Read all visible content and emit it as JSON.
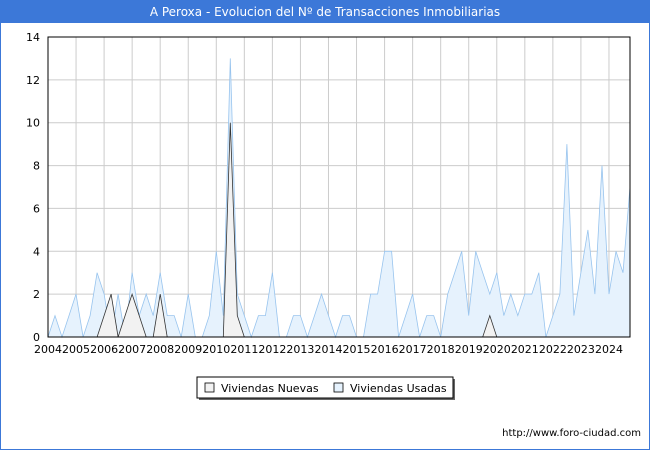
{
  "colors": {
    "title_bg": "#3c78d8",
    "nuevas_fill": "#f2f2f2",
    "nuevas_line": "#333333",
    "usadas_fill": "#e6f2fd",
    "usadas_line": "#98c4ee",
    "grid": "#cccccc"
  },
  "chart_data": {
    "type": "area",
    "title": "A Peroxa - Evolucion del Nº de Transacciones Inmobiliarias",
    "source": "http://www.foro-ciudad.com",
    "xlabel": "",
    "ylabel": "",
    "xlim": [
      2004,
      2024.75
    ],
    "ylim": [
      0,
      14
    ],
    "y_ticks": [
      "0",
      "2",
      "4",
      "6",
      "8",
      "10",
      "12",
      "14"
    ],
    "x_ticks": [
      "2004",
      "2005",
      "2006",
      "2007",
      "2008",
      "2009",
      "2010",
      "2011",
      "2012",
      "2013",
      "2014",
      "2015",
      "2016",
      "2017",
      "2018",
      "2019",
      "2020",
      "2021",
      "2022",
      "2023",
      "2024"
    ],
    "legend_position": "bottom-center",
    "grid": true,
    "series": [
      {
        "name": "Viviendas Nuevas",
        "x": [
          2004,
          2005.75,
          2006,
          2006.25,
          2006.5,
          2006.75,
          2007,
          2007.25,
          2007.5,
          2007.75,
          2008,
          2008.25,
          2010.25,
          2010.5,
          2010.75,
          2011,
          2019.5,
          2019.75,
          2020,
          2024.75
        ],
        "values": [
          0,
          0,
          1,
          2,
          0,
          1,
          2,
          1,
          0,
          0,
          2,
          0,
          0,
          10,
          1,
          0,
          0,
          1,
          0,
          0
        ]
      },
      {
        "name": "Viviendas Usadas",
        "x": [
          2004,
          2004.25,
          2004.5,
          2004.75,
          2005,
          2005.25,
          2005.5,
          2005.75,
          2006,
          2006.25,
          2006.5,
          2006.75,
          2007,
          2007.25,
          2007.5,
          2007.75,
          2008,
          2008.25,
          2008.5,
          2008.75,
          2009,
          2009.25,
          2009.5,
          2009.75,
          2010,
          2010.25,
          2010.5,
          2010.75,
          2011,
          2011.25,
          2011.5,
          2011.75,
          2012,
          2012.25,
          2012.5,
          2012.75,
          2013,
          2013.25,
          2013.5,
          2013.75,
          2014,
          2014.25,
          2014.5,
          2014.75,
          2015,
          2015.25,
          2015.5,
          2015.75,
          2016,
          2016.25,
          2016.5,
          2016.75,
          2017,
          2017.25,
          2017.5,
          2017.75,
          2018,
          2018.25,
          2018.5,
          2018.75,
          2019,
          2019.25,
          2019.5,
          2019.75,
          2020,
          2020.25,
          2020.5,
          2020.75,
          2021,
          2021.25,
          2021.5,
          2021.75,
          2022,
          2022.25,
          2022.5,
          2022.75,
          2023,
          2023.25,
          2023.5,
          2023.75,
          2024,
          2024.25,
          2024.5,
          2024.75
        ],
        "values": [
          0,
          1,
          0,
          1,
          2,
          0,
          1,
          3,
          2,
          0,
          2,
          0,
          3,
          1,
          2,
          1,
          3,
          1,
          1,
          0,
          2,
          0,
          0,
          1,
          4,
          1,
          13,
          2,
          1,
          0,
          1,
          1,
          3,
          0,
          0,
          1,
          1,
          0,
          1,
          2,
          1,
          0,
          1,
          1,
          0,
          0,
          2,
          2,
          4,
          4,
          0,
          1,
          2,
          0,
          1,
          1,
          0,
          2,
          3,
          4,
          1,
          4,
          3,
          2,
          3,
          1,
          2,
          1,
          2,
          2,
          3,
          0,
          1,
          2,
          9,
          1,
          3,
          5,
          2,
          8,
          2,
          4,
          3,
          7
        ]
      }
    ]
  }
}
